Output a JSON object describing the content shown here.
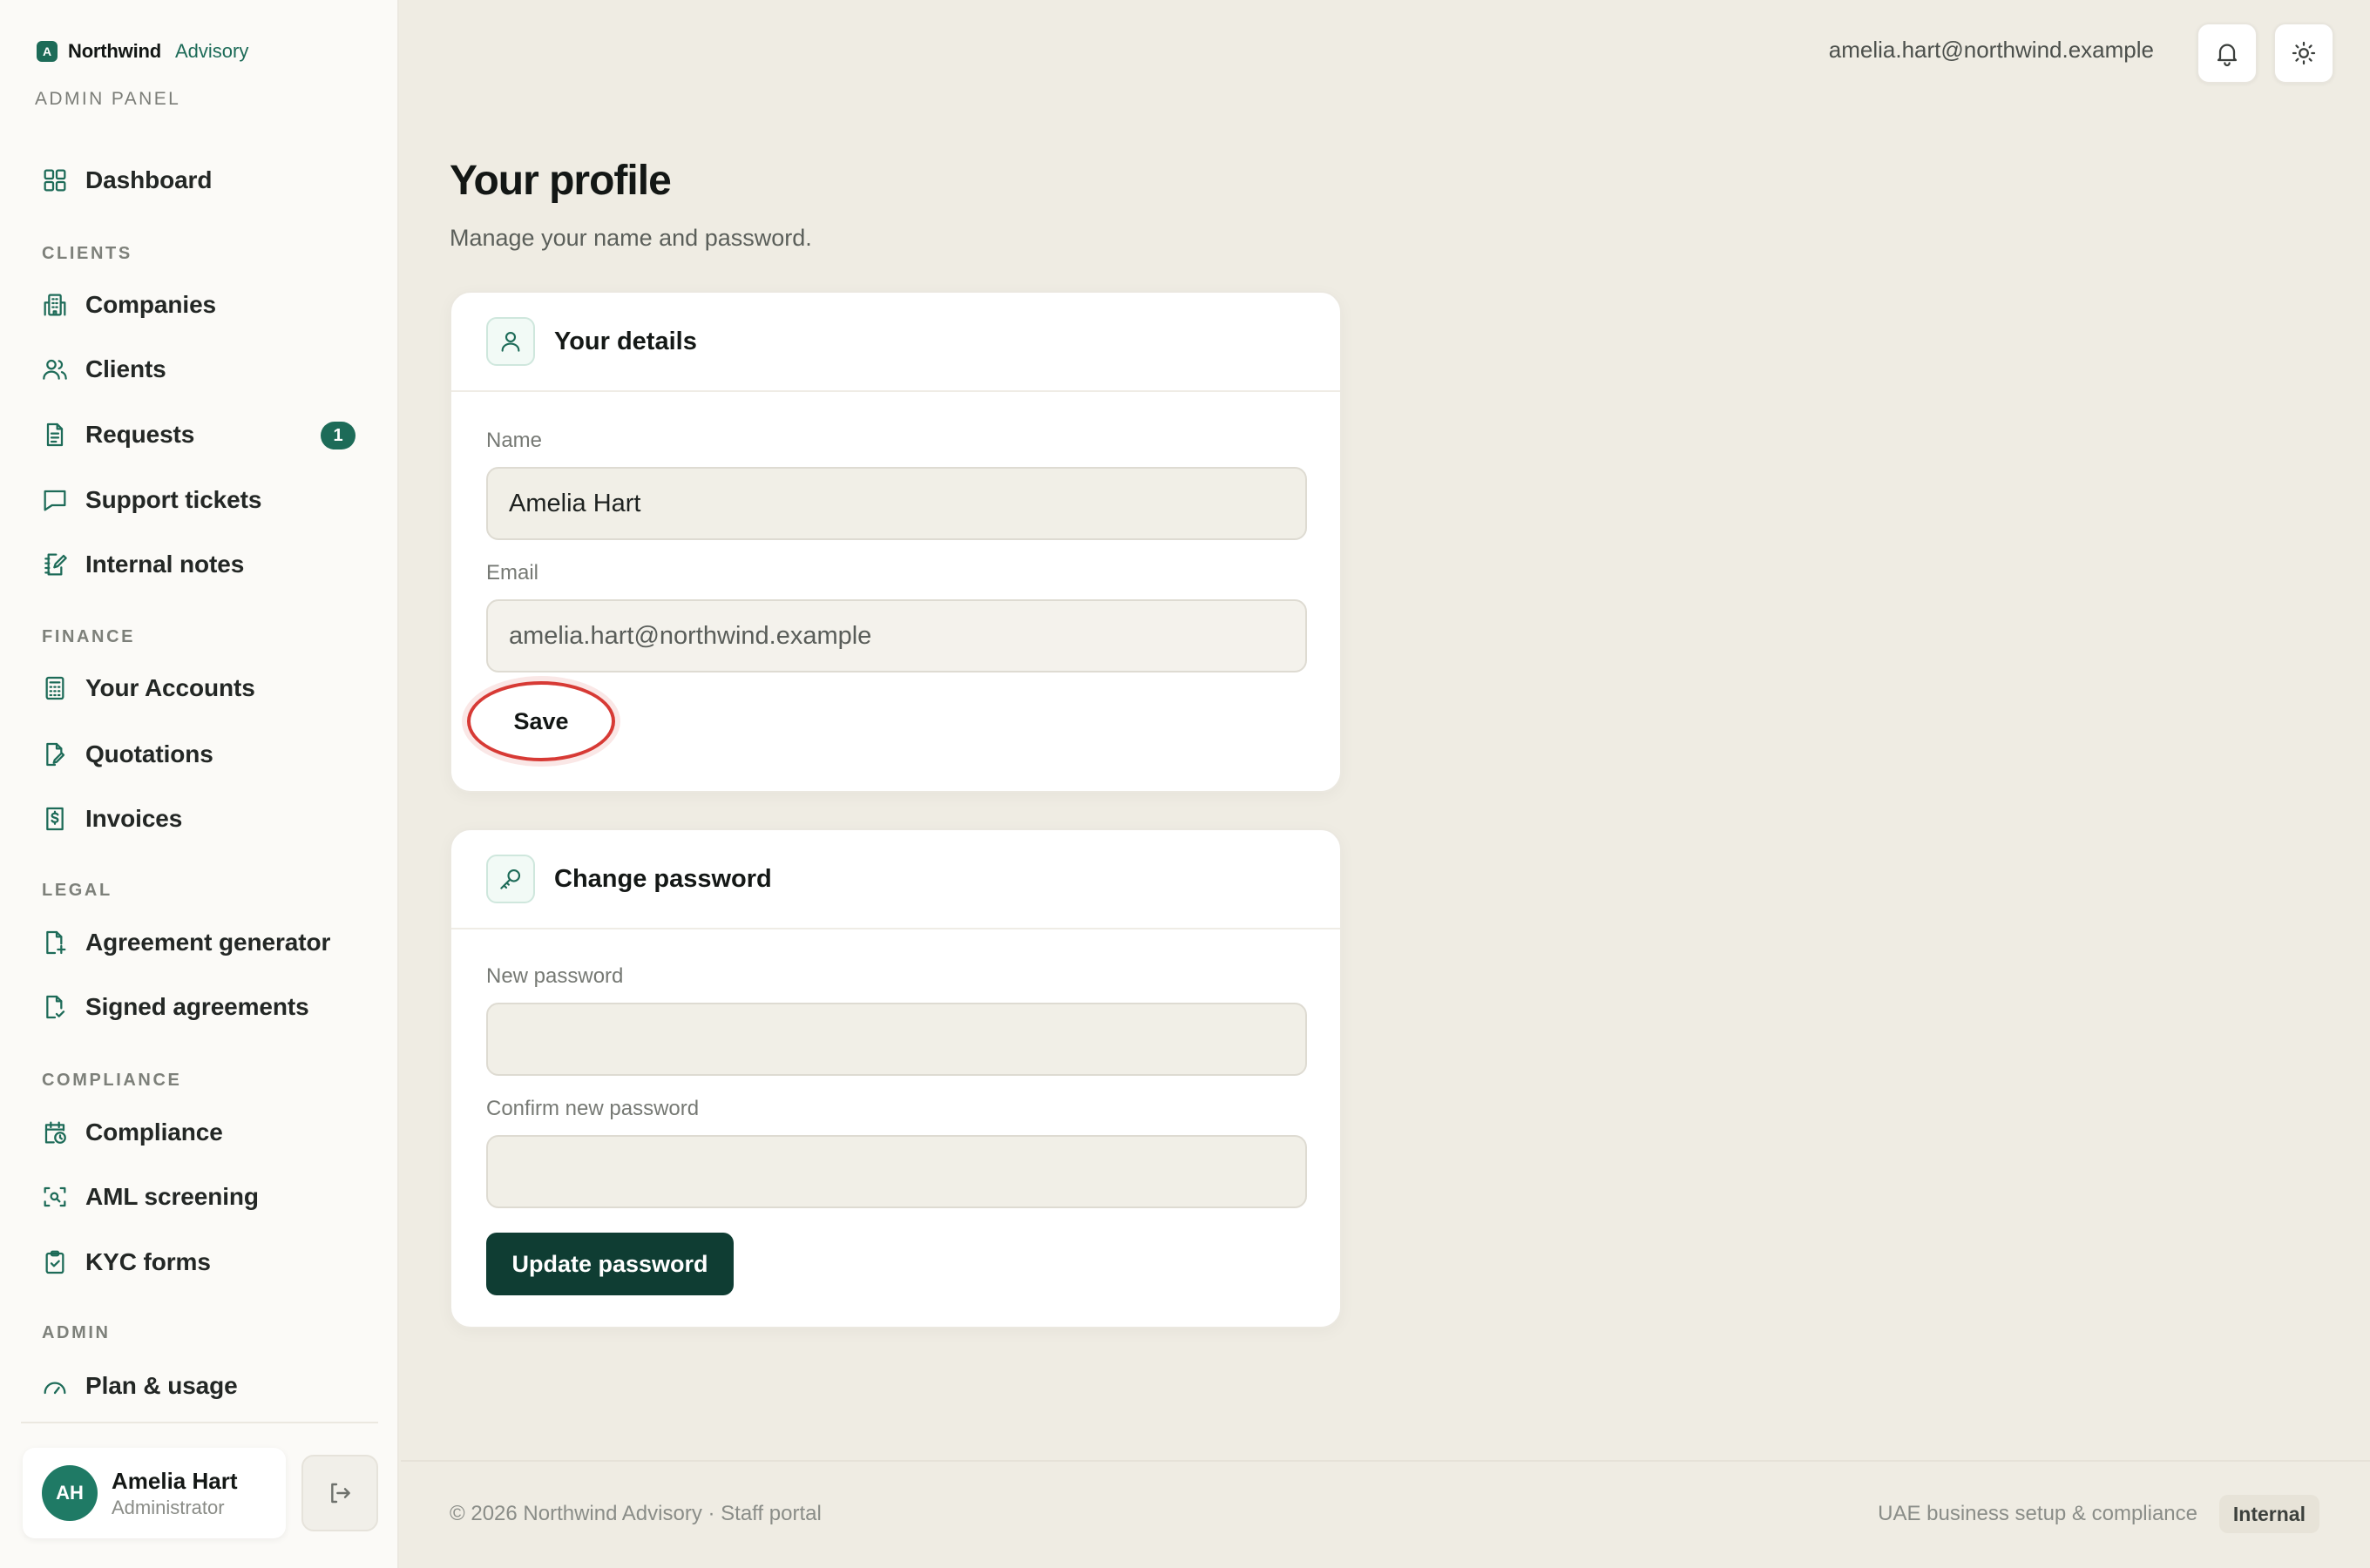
{
  "brand": {
    "name": "Northwind",
    "sub": "Advisory",
    "mark": "A"
  },
  "panel_label": "ADMIN PANEL",
  "nav": {
    "dashboard": "Dashboard",
    "sections": {
      "clients": "CLIENTS",
      "finance": "FINANCE",
      "legal": "LEGAL",
      "compliance": "COMPLIANCE",
      "admin": "ADMIN"
    },
    "items": {
      "companies": "Companies",
      "clients": "Clients",
      "requests": "Requests",
      "requests_badge": "1",
      "support_tickets": "Support tickets",
      "internal_notes": "Internal notes",
      "your_accounts": "Your Accounts",
      "quotations": "Quotations",
      "invoices": "Invoices",
      "agreement_generator": "Agreement generator",
      "signed_agreements": "Signed agreements",
      "compliance": "Compliance",
      "aml_screening": "AML screening",
      "kyc_forms": "KYC forms",
      "plan_usage": "Plan & usage"
    }
  },
  "user": {
    "initials": "AH",
    "name": "Amelia Hart",
    "role": "Administrator"
  },
  "topbar": {
    "email": "amelia.hart@northwind.example",
    "icons": [
      "bell-icon",
      "sun-icon"
    ]
  },
  "page": {
    "title": "Your profile",
    "subtitle": "Manage your name and password."
  },
  "details_card": {
    "title": "Your details",
    "name_label": "Name",
    "name_value": "Amelia Hart",
    "email_label": "Email",
    "email_value": "amelia.hart@northwind.example",
    "save_label": "Save"
  },
  "password_card": {
    "title": "Change password",
    "new_label": "New password",
    "confirm_label": "Confirm new password",
    "new_value": "",
    "confirm_value": "",
    "button_label": "Update password"
  },
  "footer": {
    "left": "© 2026 Northwind Advisory · Staff portal",
    "right": "UAE business setup & compliance",
    "chip": "Internal"
  },
  "colors": {
    "accent": "#1d6b58",
    "primary_button": "#0f3d33",
    "highlight": "#d73a35"
  }
}
